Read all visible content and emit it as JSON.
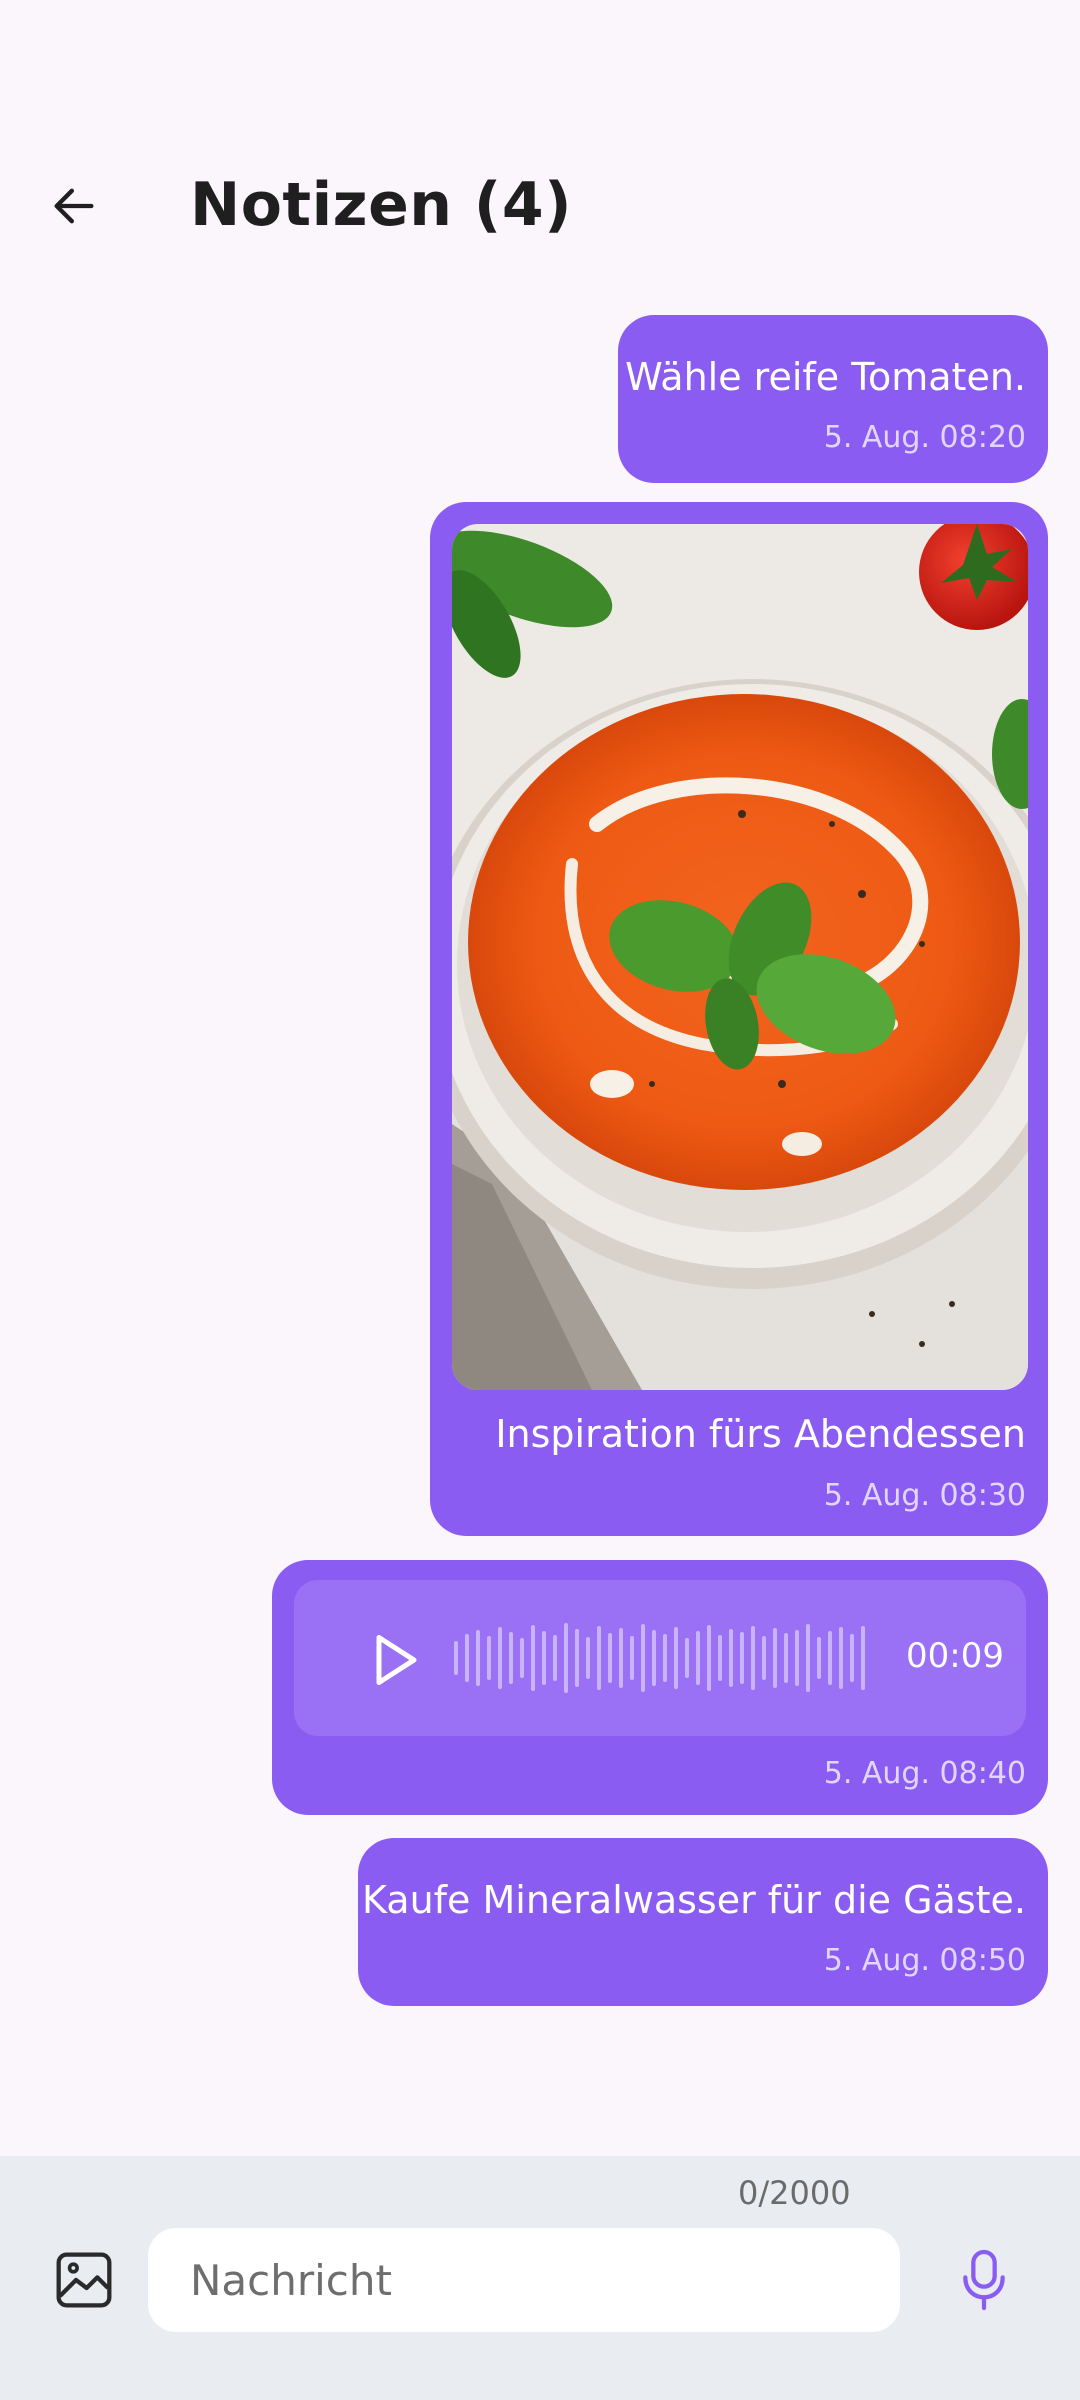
{
  "header": {
    "title": "Notizen (4)",
    "back_icon": "arrow-left-icon"
  },
  "messages": [
    {
      "type": "text",
      "text": "Wähle reife Tomaten.",
      "time": "5. Aug. 08:20"
    },
    {
      "type": "image",
      "image_icon": "tomato-soup-photo",
      "caption": "Inspiration fürs Abendessen",
      "time": "5. Aug. 08:30"
    },
    {
      "type": "voice",
      "play_icon": "play-icon",
      "duration": "00:09",
      "time": "5. Aug. 08:40"
    },
    {
      "type": "text",
      "text": "Kaufe Mineralwasser für die Gäste.",
      "time": "5. Aug. 08:50"
    }
  ],
  "composer": {
    "counter": "0/2000",
    "placeholder": "Nachricht",
    "value": "",
    "image_icon": "image-icon",
    "mic_icon": "microphone-icon"
  },
  "colors": {
    "bubble": "#8B5CF1",
    "voice_panel": "#9A70F5",
    "background": "#FBF5FC",
    "composer": "#E9ECF1",
    "accent": "#8B5CF1"
  }
}
